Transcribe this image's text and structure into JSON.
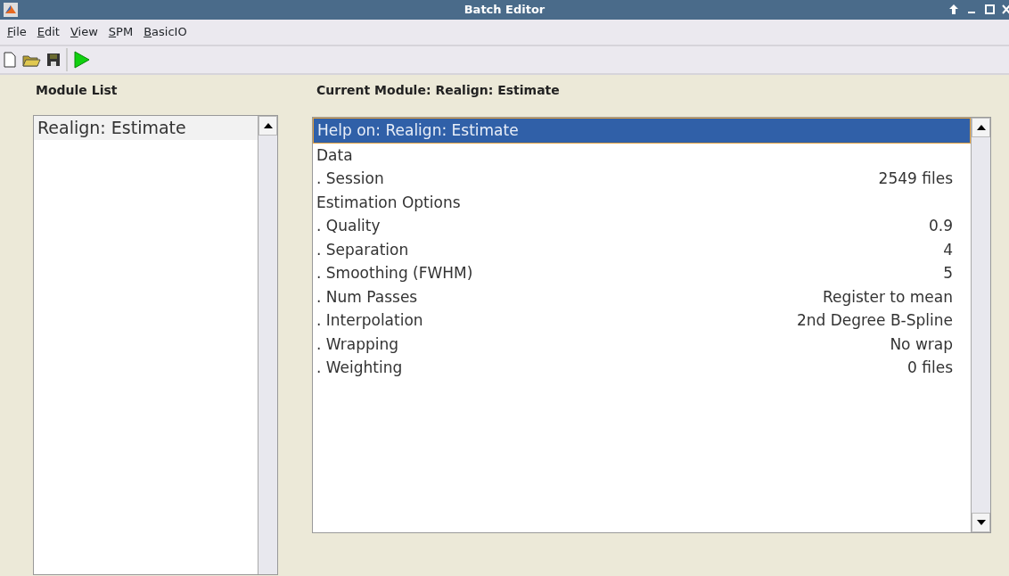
{
  "window": {
    "title": "Batch Editor"
  },
  "menu": [
    "File",
    "Edit",
    "View",
    "SPM",
    "BasicIO"
  ],
  "module_list": {
    "title": "Module List",
    "items": [
      {
        "label": "Realign: Estimate",
        "selected": false
      }
    ]
  },
  "current_module": {
    "title": "Current Module: Realign: Estimate",
    "items": [
      {
        "kind": "header",
        "label": "Help on: Realign: Estimate",
        "selected": true
      },
      {
        "kind": "header",
        "label": "Data",
        "selected": false
      },
      {
        "kind": "item",
        "label": ". Session",
        "value": "2549 files",
        "selected": false
      },
      {
        "kind": "header",
        "label": "Estimation Options",
        "selected": false
      },
      {
        "kind": "item",
        "label": ". Quality",
        "value": "0.9",
        "selected": false
      },
      {
        "kind": "item",
        "label": ". Separation",
        "value": "4",
        "selected": false
      },
      {
        "kind": "item",
        "label": ". Smoothing (FWHM)",
        "value": "5",
        "selected": false
      },
      {
        "kind": "item",
        "label": ". Num Passes",
        "value": "Register to mean",
        "selected": false
      },
      {
        "kind": "item",
        "label": ". Interpolation",
        "value": "2nd Degree B-Spline",
        "selected": false
      },
      {
        "kind": "item",
        "label": ". Wrapping",
        "value": "No wrap",
        "selected": false
      },
      {
        "kind": "item",
        "label": ". Weighting",
        "value": "0 files",
        "selected": false
      }
    ]
  }
}
